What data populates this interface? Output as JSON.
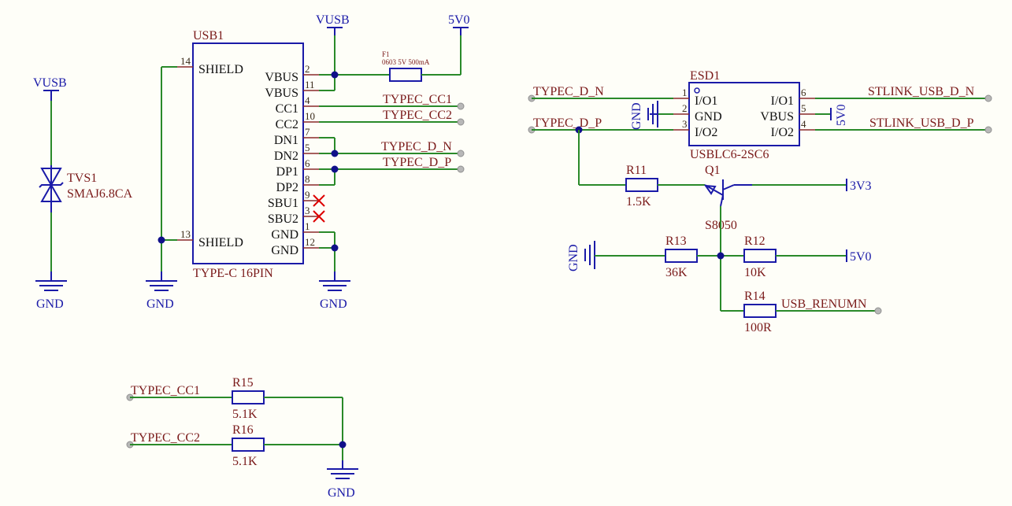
{
  "usb1": {
    "ref": "USB1",
    "value": "TYPE-C 16PIN",
    "left_pins": [
      {
        "num": "14",
        "name": "SHIELD"
      },
      {
        "num": "13",
        "name": "SHIELD"
      }
    ],
    "right_pins": [
      {
        "num": "2",
        "name": "VBUS"
      },
      {
        "num": "11",
        "name": "VBUS"
      },
      {
        "num": "4",
        "name": "CC1"
      },
      {
        "num": "10",
        "name": "CC2"
      },
      {
        "num": "7",
        "name": "DN1"
      },
      {
        "num": "5",
        "name": "DN2"
      },
      {
        "num": "6",
        "name": "DP1"
      },
      {
        "num": "8",
        "name": "DP2"
      },
      {
        "num": "9",
        "name": "SBU1"
      },
      {
        "num": "3",
        "name": "SBU2"
      },
      {
        "num": "1",
        "name": "GND"
      },
      {
        "num": "12",
        "name": "GND"
      }
    ]
  },
  "tvs1": {
    "ref": "TVS1",
    "value": "SMAJ6.8CA"
  },
  "f1": {
    "ref": "F1",
    "value": "0603 5V 500mA"
  },
  "power": {
    "vusb_tvs": "VUSB",
    "vusb_usb": "VUSB",
    "v5_top": "5V0",
    "gnd_tvs": "GND",
    "gnd_shield": "GND",
    "gnd_usb": "GND",
    "gnd_esd": "GND",
    "v5_esd": "5V0",
    "v3v3": "3V3",
    "gnd_r13": "GND",
    "v5_r12": "5V0",
    "gnd_cc": "GND"
  },
  "nets": {
    "cc1": "TYPEC_CC1",
    "cc2": "TYPEC_CC2",
    "dn": "TYPEC_D_N",
    "dp": "TYPEC_D_P",
    "esd_dn": "TYPEC_D_N",
    "esd_dp": "TYPEC_D_P",
    "st_dn": "STLINK_USB_D_N",
    "st_dp": "STLINK_USB_D_P",
    "renum": "USB_RENUMN",
    "r15_net": "TYPEC_CC1",
    "r16_net": "TYPEC_CC2"
  },
  "esd1": {
    "ref": "ESD1",
    "value": "USBLC6-2SC6",
    "left_pins": [
      {
        "num": "1",
        "name": "I/O1"
      },
      {
        "num": "2",
        "name": "GND"
      },
      {
        "num": "3",
        "name": "I/O2"
      }
    ],
    "right_pins": [
      {
        "num": "6",
        "name": "I/O1"
      },
      {
        "num": "5",
        "name": "VBUS"
      },
      {
        "num": "4",
        "name": "I/O2"
      }
    ]
  },
  "q1": {
    "ref": "Q1",
    "value": "S8050"
  },
  "resistors": [
    {
      "ref": "R11",
      "value": "1.5K"
    },
    {
      "ref": "R13",
      "value": "36K"
    },
    {
      "ref": "R12",
      "value": "10K"
    },
    {
      "ref": "R14",
      "value": "100R"
    },
    {
      "ref": "R15",
      "value": "5.1K"
    },
    {
      "ref": "R16",
      "value": "5.1K"
    }
  ]
}
